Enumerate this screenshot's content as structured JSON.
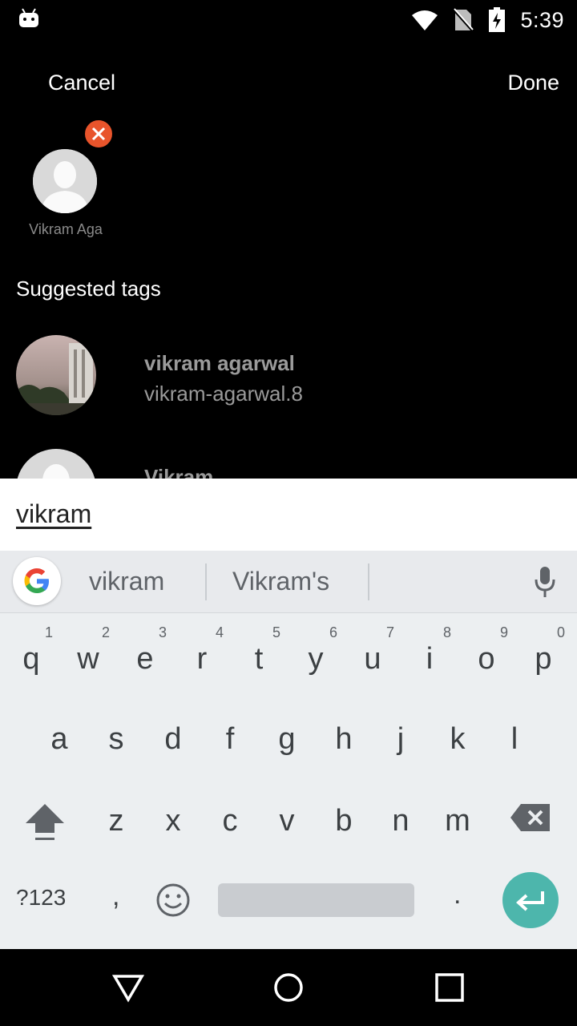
{
  "status_bar": {
    "time": "5:39",
    "icons": [
      "android-icon",
      "wifi-icon",
      "no-sim-icon",
      "battery-charging-icon"
    ]
  },
  "header": {
    "cancel_label": "Cancel",
    "done_label": "Done"
  },
  "selected_tags": [
    {
      "name": "Vikram Aga"
    }
  ],
  "suggested": {
    "title": "Suggested tags",
    "items": [
      {
        "name": "vikram agarwal",
        "username": "vikram-agarwal.8"
      },
      {
        "name": "Vikram",
        "username": ""
      }
    ]
  },
  "search": {
    "value": "vikram"
  },
  "keyboard": {
    "suggestions": [
      "vikram",
      "Vikram's"
    ],
    "row1": [
      {
        "key": "q",
        "hint": "1"
      },
      {
        "key": "w",
        "hint": "2"
      },
      {
        "key": "e",
        "hint": "3"
      },
      {
        "key": "r",
        "hint": "4"
      },
      {
        "key": "t",
        "hint": "5"
      },
      {
        "key": "y",
        "hint": "6"
      },
      {
        "key": "u",
        "hint": "7"
      },
      {
        "key": "i",
        "hint": "8"
      },
      {
        "key": "o",
        "hint": "9"
      },
      {
        "key": "p",
        "hint": "0"
      }
    ],
    "row2": [
      "a",
      "s",
      "d",
      "f",
      "g",
      "h",
      "j",
      "k",
      "l"
    ],
    "row3": [
      "z",
      "x",
      "c",
      "v",
      "b",
      "n",
      "m"
    ],
    "symbols_label": "?123",
    "comma_label": ",",
    "period_label": ".",
    "accent_color": "#4db6ac"
  },
  "colors": {
    "remove_badge": "#e8542b",
    "background": "#000000"
  }
}
